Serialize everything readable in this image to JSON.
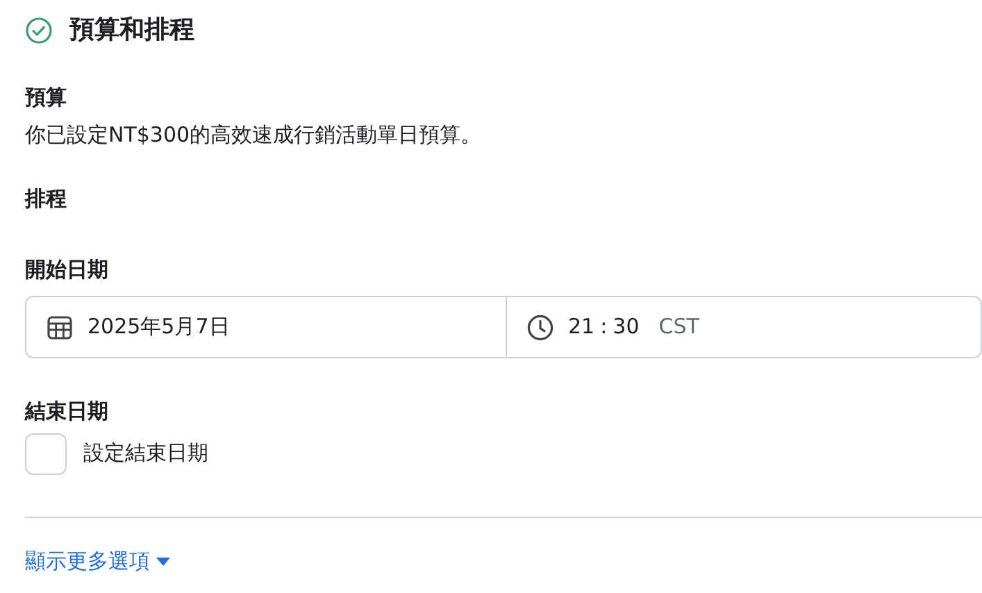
{
  "section": {
    "title": "預算和排程"
  },
  "budget": {
    "label": "預算",
    "description": "你已設定NT$300的高效速成行銷活動單日預算。"
  },
  "schedule": {
    "label": "排程"
  },
  "start_date": {
    "label": "開始日期",
    "date": "2025年5月7日",
    "hour": "21",
    "separator": ":",
    "minute": "30",
    "timezone": "CST"
  },
  "end_date": {
    "label": "結束日期",
    "checkbox_label": "設定結束日期",
    "checked": false
  },
  "more_options": {
    "label": "顯示更多選項"
  }
}
